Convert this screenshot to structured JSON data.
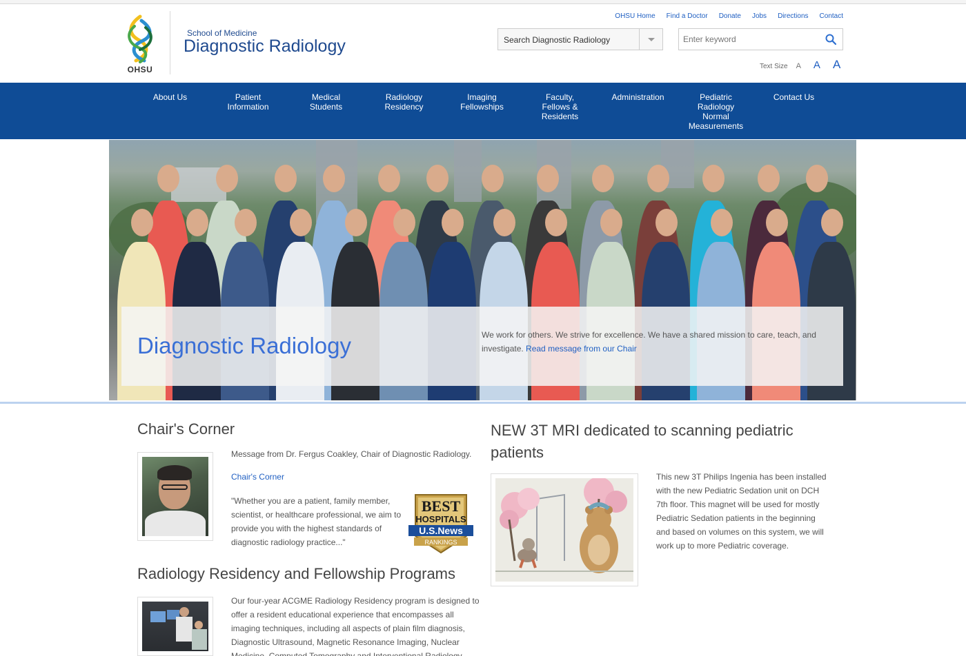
{
  "header": {
    "logo_text": "OHSU",
    "school": "School of Medicine",
    "department": "Diagnostic Radiology",
    "top_links": [
      "OHSU Home",
      "Find a Doctor",
      "Donate",
      "Jobs",
      "Directions",
      "Contact"
    ],
    "search_scope": "Search Diagnostic Radiology",
    "keyword_placeholder": "Enter keyword",
    "text_size_label": "Text Size",
    "text_size_options": [
      "A",
      "A",
      "A"
    ]
  },
  "nav": {
    "items": [
      "About Us",
      "Patient\nInformation",
      "Medical\nStudents",
      "Radiology\nResidency",
      "Imaging\nFellowships",
      "Faculty,\nFellows &\nResidents",
      "Administration",
      "Pediatric\nRadiology\nNormal\nMeasurements",
      "Contact Us"
    ]
  },
  "hero": {
    "title": "Diagnostic Radiology",
    "text": "We work for others. We strive for excellence. We have a shared mission to care, teach, and investigate.",
    "link": "Read message from our Chair"
  },
  "chair": {
    "title": "Chair's Corner",
    "message": "Message from Dr. Fergus Coakley, Chair of Diagnostic Radiology.",
    "link": "Chair's Corner",
    "quote": "\"Whether you are a patient, family member, scientist, or healthcare professional, we aim to provide you with the highest standards of diagnostic radiology practice...\""
  },
  "badge": {
    "line1": "BEST",
    "line2": "HOSPITALS",
    "line3": "U.S.News",
    "line4": "RANKINGS"
  },
  "residency": {
    "title": "Radiology Residency and Fellowship Programs",
    "text": "Our four-year ACGME Radiology Residency program is designed to offer a resident educational experience that encompasses all imaging techniques, including all aspects of plain film diagnosis, Diagnostic Ultrasound, Magnetic Resonance Imaging, Nuclear Medicine, Computed Tomography and Interventional Radiology."
  },
  "mri": {
    "title": "NEW 3T MRI dedicated to scanning pediatric patients",
    "text": "This new 3T Philips Ingenia has been installed with the new Pediatric Sedation unit on DCH 7th floor. This magnet will be used for mostly Pediatric Sedation patients in the beginning and based on volumes on this system, we will work up to more Pediatric coverage."
  },
  "colors": {
    "nav_bg": "#0f4c96",
    "link": "#1f5fc2",
    "title_blue": "#3a6fd6"
  }
}
